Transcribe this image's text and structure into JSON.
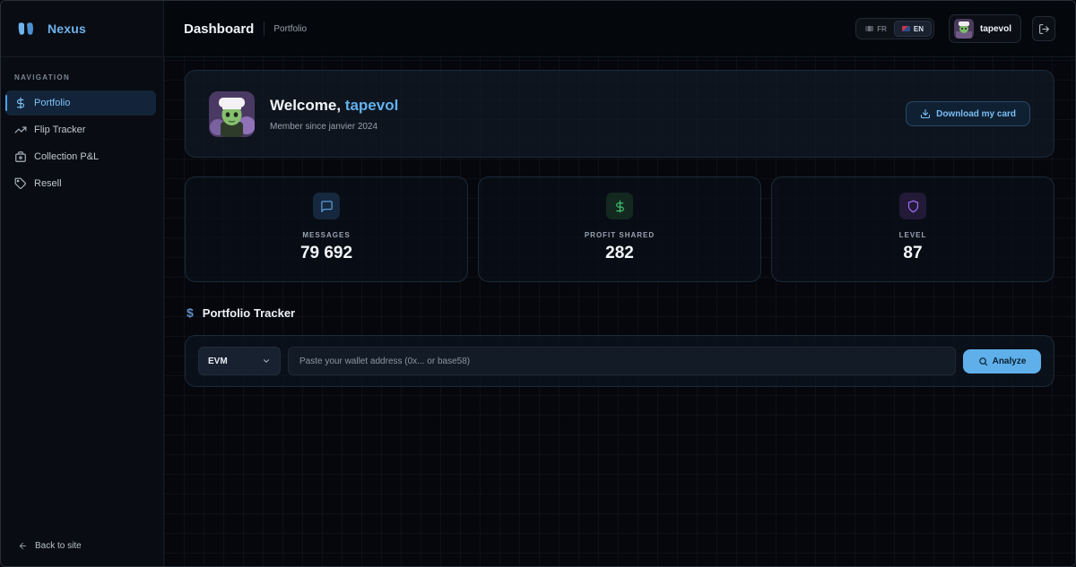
{
  "brand": {
    "name": "Nexus"
  },
  "sidebar": {
    "section_title": "NAVIGATION",
    "items": [
      {
        "label": "Portfolio",
        "icon": "dollar-icon",
        "active": true
      },
      {
        "label": "Flip Tracker",
        "icon": "trending-up-icon",
        "active": false
      },
      {
        "label": "Collection P&L",
        "icon": "briefcase-icon",
        "active": false
      },
      {
        "label": "Resell",
        "icon": "tag-icon",
        "active": false
      }
    ],
    "back_label": "Back to site"
  },
  "header": {
    "title": "Dashboard",
    "breadcrumb": "Portfolio",
    "languages": [
      {
        "code": "FR",
        "active": false
      },
      {
        "code": "EN",
        "active": true
      }
    ],
    "username": "tapevol"
  },
  "welcome": {
    "greeting": "Welcome,",
    "name": "tapevol",
    "member_since": "Member since janvier 2024",
    "download_label": "Download my card"
  },
  "stats": [
    {
      "label": "MESSAGES",
      "value": "79 692",
      "icon": "message-icon",
      "color": "#4f8fd0"
    },
    {
      "label": "PROFIT SHARED",
      "value": "282",
      "icon": "dollar-icon",
      "color": "#3fbf6f"
    },
    {
      "label": "LEVEL",
      "value": "87",
      "icon": "shield-icon",
      "color": "#9b6cf0"
    }
  ],
  "tracker": {
    "title": "Portfolio Tracker",
    "chain_selected": "EVM",
    "wallet_placeholder": "Paste your wallet address (0x... or base58)",
    "analyze_label": "Analyze"
  },
  "colors": {
    "accent": "#5fb0ea",
    "background": "#05070c"
  }
}
